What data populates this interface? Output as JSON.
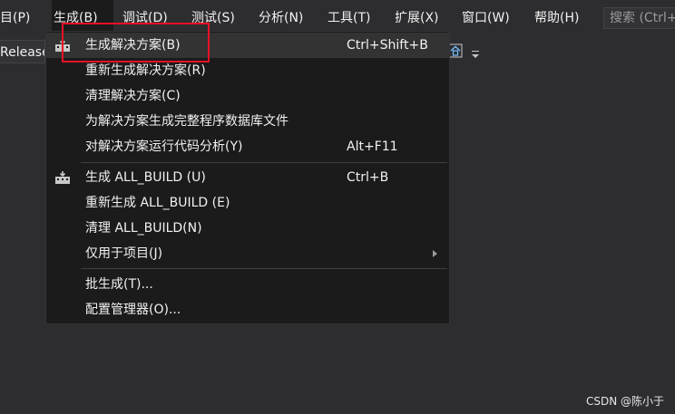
{
  "menubar": {
    "items": [
      {
        "label": "项目(P)",
        "visible": "目(P)"
      },
      {
        "label": "生成(B)"
      },
      {
        "label": "调试(D)"
      },
      {
        "label": "测试(S)"
      },
      {
        "label": "分析(N)"
      },
      {
        "label": "工具(T)"
      },
      {
        "label": "扩展(X)"
      },
      {
        "label": "窗口(W)"
      },
      {
        "label": "帮助(H)"
      }
    ],
    "search_placeholder": "搜索 (Ctrl+Q)"
  },
  "toolbar": {
    "configuration": "Release"
  },
  "build_menu": {
    "items": [
      {
        "label": "生成解决方案(B)",
        "shortcut": "Ctrl+Shift+B",
        "icon": "build-icon"
      },
      {
        "label": "重新生成解决方案(R)",
        "shortcut": ""
      },
      {
        "label": "清理解决方案(C)",
        "shortcut": ""
      },
      {
        "label": "为解决方案生成完整程序数据库文件",
        "shortcut": ""
      },
      {
        "label": "对解决方案运行代码分析(Y)",
        "shortcut": "Alt+F11"
      },
      {
        "label": "生成 ALL_BUILD (U)",
        "shortcut": "Ctrl+B",
        "icon": "build-icon"
      },
      {
        "label": "重新生成 ALL_BUILD (E)",
        "shortcut": ""
      },
      {
        "label": "清理 ALL_BUILD(N)",
        "shortcut": ""
      },
      {
        "label": "仅用于项目(J)",
        "shortcut": "",
        "submenu": true
      },
      {
        "label": "批生成(T)...",
        "shortcut": ""
      },
      {
        "label": "配置管理器(O)...",
        "shortcut": ""
      }
    ]
  },
  "colors": {
    "background": "#2d2d30",
    "menu_background": "#1b1b1c",
    "highlight": "#333334",
    "annotation": "#e81123"
  },
  "watermark": "CSDN @陈小于"
}
